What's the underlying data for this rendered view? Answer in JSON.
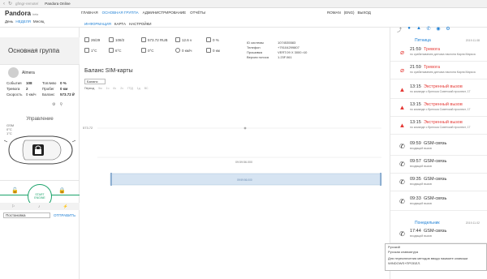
{
  "browser": {
    "url": "gfmgr-remote/",
    "tab_title": "Pandora Online"
  },
  "app": {
    "brand": "Pandora",
    "brand_sub": "beta"
  },
  "modes": {
    "items": [
      "День",
      "НЕДЕЛЯ",
      "Месяц"
    ],
    "active": 1
  },
  "main_menu": {
    "items": [
      "ГЛАВНАЯ",
      "ОСНОВНАЯ ГРУППА",
      "АДМИНИСТРИРОВАНИЕ",
      "ОТЧЁТЫ"
    ],
    "active": 1
  },
  "sub_menu": {
    "items": [
      "ИНФОРМАЦИЯ",
      "КАРТА",
      "НАСТРОЙКИ"
    ],
    "active": 0
  },
  "user": {
    "name": "ROMAN",
    "lang": "(ENG)",
    "logout": "ВЫХОД"
  },
  "top_icons": [
    "share-icon",
    "user-icon",
    "warning-icon",
    "phone-icon",
    "vehicle-icon",
    "settings-icon"
  ],
  "left": {
    "group_title": "Основная группа",
    "device_name": "Almera",
    "stats": [
      {
        "label": "События",
        "value": "108",
        "label2": "Топливо",
        "value2": "0 %"
      },
      {
        "label": "Тревога",
        "value": "2",
        "label2": "Пробег",
        "value2": "0 км"
      },
      {
        "label": "Скорость",
        "value": "0 км/ч",
        "label2": "Баланс",
        "value2": "573.72 ₽"
      }
    ],
    "control_title": "Управление",
    "minor": [
      "GSM",
      "0°C",
      "1°C"
    ],
    "start": {
      "line1": "START",
      "line2": "ENGINE"
    },
    "command": {
      "value": "Постановка",
      "send": "ОТПРАВИТЬ"
    }
  },
  "metrics": {
    "sms": "26/29",
    "sim_state": "108/2",
    "balance": "573.72 RUB",
    "voltage": "12.6 v",
    "fuel": "0 %",
    "temp_engine": "1°C",
    "temp_cabin": "6°C",
    "temp_out": "0°C",
    "speed": "0 км/ч",
    "mileage": "0 км"
  },
  "ids": [
    {
      "label": "ID системы",
      "value": "1074535583"
    },
    {
      "label": "Телефон",
      "value": "+79104299807"
    },
    {
      "label": "Прошивка",
      "value": "VERT.09 X 3000 r10"
    },
    {
      "label": "Версия голоса",
      "value": "1.23F.061"
    }
  ],
  "sim_chart": {
    "title": "Баланс SIM-карты",
    "period_select": "Баланс",
    "periods": [
      "Период",
      "5м",
      "1ч",
      "6ч",
      "2ч",
      "ГПД",
      "1д",
      "ВС"
    ],
    "value_label": "573.72",
    "time_label": "09:59:56.000",
    "range_label": "09:59:56.000"
  },
  "chart_data": {
    "type": "line",
    "x": [
      "09:59:56.000"
    ],
    "series": [
      {
        "values": [
          573.72
        ]
      }
    ]
  },
  "events": {
    "days": [
      {
        "name": "Пятница",
        "date": "2019.11.08"
      },
      {
        "name": "Понедельник",
        "date": "2019.11.02"
      }
    ],
    "items": [
      {
        "time": "21:59",
        "name": "Тревога",
        "desc": "по срабатыванию датчика наклона Карла Маркса",
        "type": "alarm"
      },
      {
        "time": "21:59",
        "name": "Тревога",
        "desc": "по срабатыванию датчика наклона Карла Маркса",
        "type": "alarm"
      },
      {
        "time": "13:15",
        "name": "Экстренный вызов",
        "desc": "по команде с брелока Советский проспект, 17",
        "type": "emergency"
      },
      {
        "time": "13:15",
        "name": "Экстренный вызов",
        "desc": "по команде с брелока Советский проспект, 17",
        "type": "emergency"
      },
      {
        "time": "13:15",
        "name": "Экстренный вызов",
        "desc": "по команде с брелока Советский проспект, 17",
        "type": "emergency"
      },
      {
        "time": "09:59",
        "name": "GSM-связь",
        "desc": "входящий вызов",
        "type": "gsm"
      },
      {
        "time": "09:57",
        "name": "GSM-связь",
        "desc": "входящий вызов",
        "type": "gsm"
      },
      {
        "time": "09:35",
        "name": "GSM-связь",
        "desc": "входящий вызов",
        "type": "gsm"
      },
      {
        "time": "09:33",
        "name": "GSM-связь",
        "desc": "входящий вызов",
        "type": "gsm"
      },
      {
        "time": "17:44",
        "name": "GSM-связь",
        "desc": "входящий вызов",
        "type": "gsm"
      },
      {
        "time": "16:37",
        "name": "GSM-связь",
        "desc": "входящий вызов",
        "type": "gsm"
      }
    ]
  },
  "tooltip": {
    "lines": [
      "Русский",
      "Русская клавиатура",
      "",
      "Для переключения методов ввода нажмите клавиши WINDOWS+ПРОБЕЛ."
    ]
  },
  "colors": {
    "accent": "#1d7fd4",
    "alarm": "#e53935",
    "ok": "#1ca36b"
  }
}
